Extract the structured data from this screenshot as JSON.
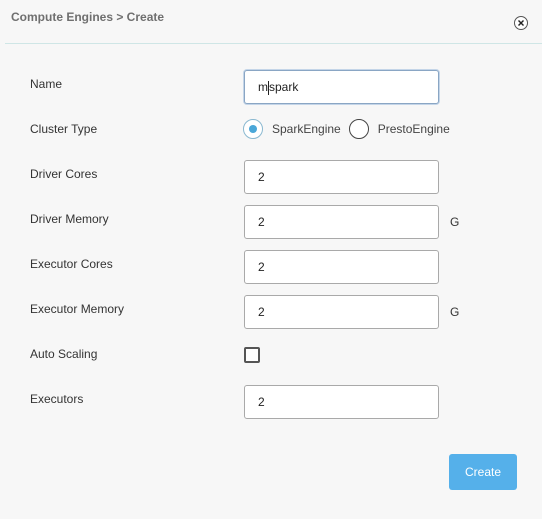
{
  "header": {
    "breadcrumb": "Compute Engines > Create"
  },
  "form": {
    "name": {
      "label": "Name",
      "value": "mspark",
      "value_pre_caret": "m",
      "value_post_caret": "spark"
    },
    "cluster_type": {
      "label": "Cluster Type",
      "options": [
        {
          "label": "SparkEngine",
          "selected": true
        },
        {
          "label": "PrestoEngine",
          "selected": false
        }
      ]
    },
    "driver_cores": {
      "label": "Driver Cores",
      "value": "2"
    },
    "driver_memory": {
      "label": "Driver Memory",
      "value": "2",
      "unit": "G"
    },
    "executor_cores": {
      "label": "Executor Cores",
      "value": "2"
    },
    "executor_memory": {
      "label": "Executor Memory",
      "value": "2",
      "unit": "G"
    },
    "auto_scaling": {
      "label": "Auto Scaling",
      "checked": false
    },
    "executors": {
      "label": "Executors",
      "value": "2"
    }
  },
  "actions": {
    "create_label": "Create"
  },
  "colors": {
    "accent": "#55b0ea",
    "radio_selected": "#4aa7d8",
    "divider": "#cfe6e6",
    "background": "#f7f7f7"
  },
  "icons": {
    "close": "close-icon"
  }
}
